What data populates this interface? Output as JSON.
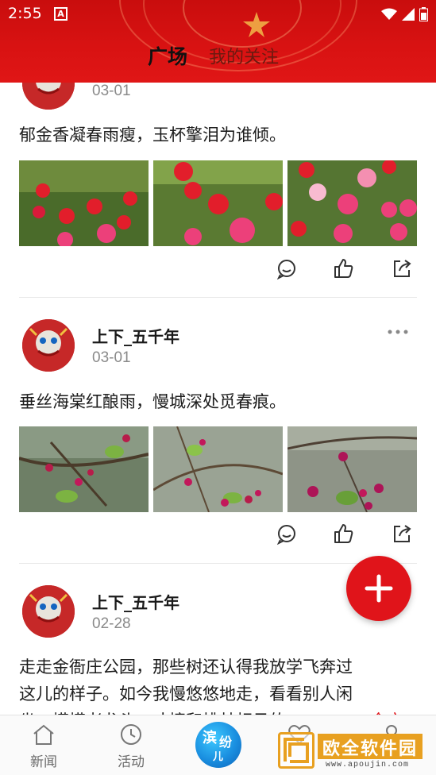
{
  "status_bar": {
    "time": "2:55",
    "app_icon_letter": "A"
  },
  "header": {
    "tabs": [
      {
        "label": "广场",
        "active": true
      },
      {
        "label": "我的关注",
        "active": false
      }
    ]
  },
  "posts": [
    {
      "username": "",
      "date": "03-01",
      "text": "郁金香凝春雨瘦，玉杯擎泪为谁倾。",
      "images": [
        "tulip-photo-1",
        "tulip-photo-2",
        "tulip-photo-3"
      ]
    },
    {
      "username": "上下_五千年",
      "date": "03-01",
      "text": "垂丝海棠红酿雨，慢城深处觅春痕。",
      "images": [
        "crabapple-photo-1",
        "crabapple-photo-2",
        "crabapple-photo-3"
      ]
    },
    {
      "username": "上下_五千年",
      "date": "02-28",
      "text_line1": "走走金衙庄公园，那些树还认得我放学飞奔过",
      "text_line2": "这儿的样子。如今我慢悠悠地走，看看别人闲",
      "text_line3_partial": "坐，摸摸老龙头，才撞和桃林相见的",
      "full_text_link": "全文"
    }
  ],
  "fab": {
    "icon": "plus-icon"
  },
  "bottom_nav": {
    "items": [
      {
        "label": "新闻",
        "icon": "home-icon"
      },
      {
        "label": "活动",
        "icon": "clock-icon"
      },
      {
        "label": "滨纷儿",
        "icon": "center-logo"
      },
      {
        "label": "",
        "icon": "heart-icon"
      },
      {
        "label": "",
        "icon": "person-icon"
      }
    ]
  },
  "watermark": {
    "text": "欧全软件园",
    "url": "www.apoujin.com"
  },
  "colors": {
    "brand_red": "#e0141a",
    "header_red": "#d81212",
    "date_gray": "#8a8a8a",
    "watermark_orange": "#e8a020"
  }
}
